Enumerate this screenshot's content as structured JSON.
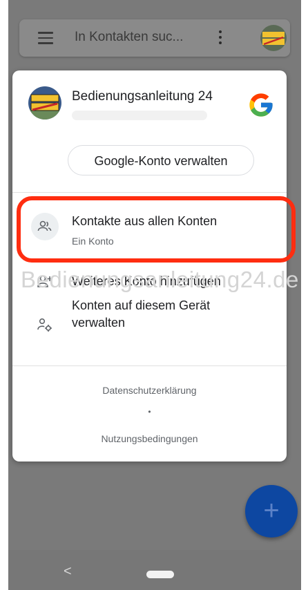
{
  "search": {
    "placeholder_text": "In Kontakten suc..."
  },
  "account": {
    "name": "Bedienungsanleitung 24",
    "manage_button": "Google-Konto verwalten"
  },
  "menu_items": [
    {
      "title": "Kontakte aus allen Konten",
      "subtitle": "Ein Konto",
      "icon": "people-icon"
    },
    {
      "title": "Weiteres Konto hinzufügen",
      "icon": "person-add-icon"
    },
    {
      "title": "Konten auf diesem Gerät",
      "title_line2": "verwalten",
      "icon": "manage-accounts-icon"
    }
  ],
  "footer": {
    "privacy": "Datenschutzerklärung",
    "separator": "•",
    "terms": "Nutzungsbedingungen"
  },
  "watermark": "Bedienungsanleitung24.de",
  "fab": {
    "label": "+"
  },
  "nav": {
    "back_label": "<"
  },
  "colors": {
    "highlight": "#ff2d10",
    "fab": "#0d47a1",
    "dim_background": "#7a7a7a"
  }
}
